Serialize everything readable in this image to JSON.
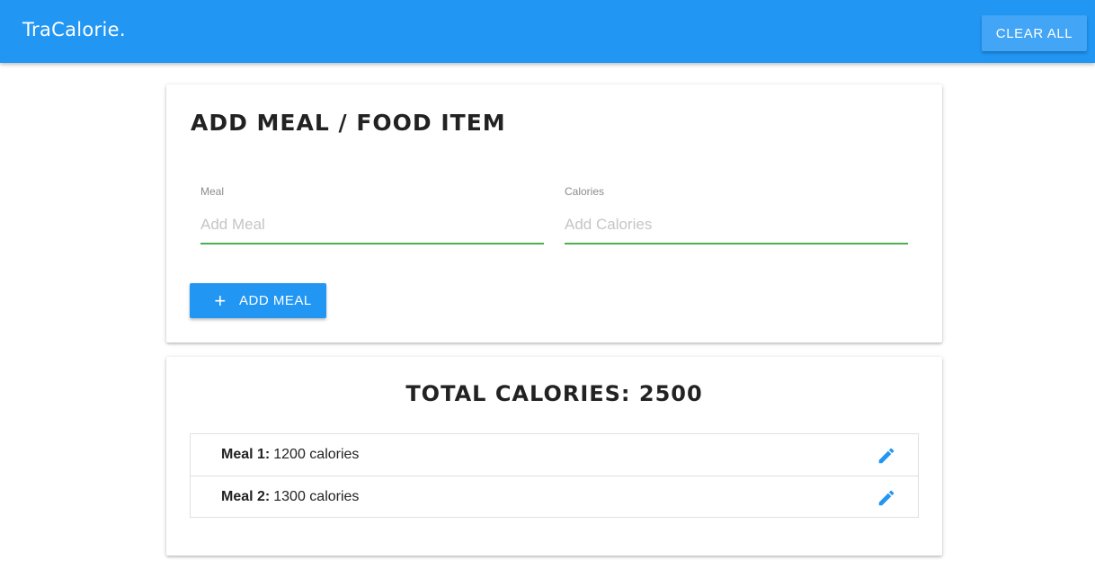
{
  "app": {
    "brand": "TraCalorie.",
    "clear_label": "CLEAR ALL"
  },
  "colors": {
    "brand": "#2196f3",
    "accent": "#4caf50"
  },
  "add_form": {
    "title": "ADD MEAL / FOOD ITEM",
    "meal_label": "Meal",
    "meal_placeholder": "Add Meal",
    "meal_value": "",
    "calories_label": "Calories",
    "calories_placeholder": "Add Calories",
    "calories_value": "",
    "add_button_icon": "plus-icon",
    "add_button_label": "ADD MEAL"
  },
  "summary": {
    "total_text": "TOTAL CALORIES: 2500"
  },
  "meals": [
    {
      "name": "Meal 1:",
      "calories": "1200 calories",
      "icon": "pencil-icon"
    },
    {
      "name": "Meal 2:",
      "calories": "1300 calories",
      "icon": "pencil-icon"
    }
  ]
}
